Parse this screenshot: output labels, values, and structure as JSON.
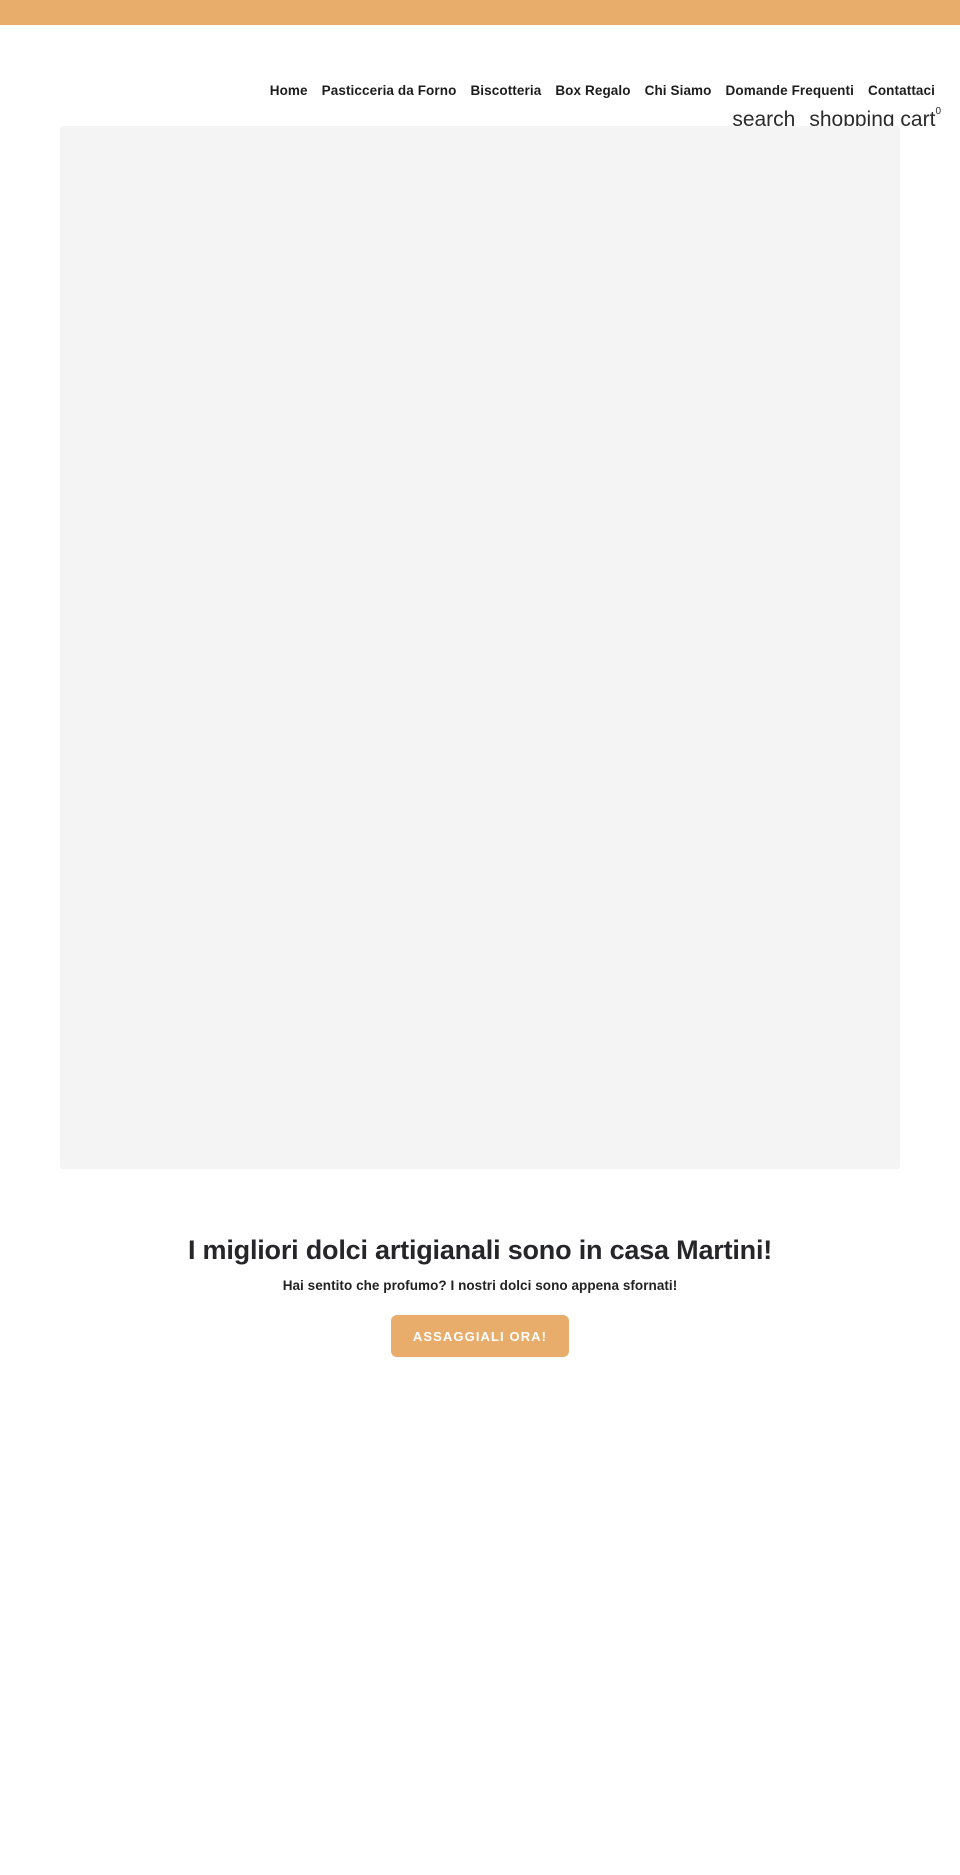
{
  "colors": {
    "accent": "#e8ac6b",
    "placeholder_bg": "#f4f4f4",
    "text": "#222222",
    "button_text": "#ffffff"
  },
  "topbar": {
    "label": ""
  },
  "header": {
    "nav": [
      {
        "label": "Home"
      },
      {
        "label": "Pasticceria da Forno"
      },
      {
        "label": "Biscotteria"
      },
      {
        "label": "Box Regalo"
      },
      {
        "label": "Chi Siamo"
      },
      {
        "label": "Domande Frequenti"
      },
      {
        "label": "Contattaci"
      }
    ],
    "utilities": {
      "search_label": "search",
      "cart_label": "shopping cart",
      "cart_count": "0"
    }
  },
  "hero": {
    "alt": "hero-image-placeholder"
  },
  "promo": {
    "title": "I migliori dolci artigianali sono in casa Martini!",
    "subtitle": "Hai sentito che profumo? I nostri dolci sono appena sfornati!",
    "cta_label": "ASSAGGIALI ORA!"
  }
}
